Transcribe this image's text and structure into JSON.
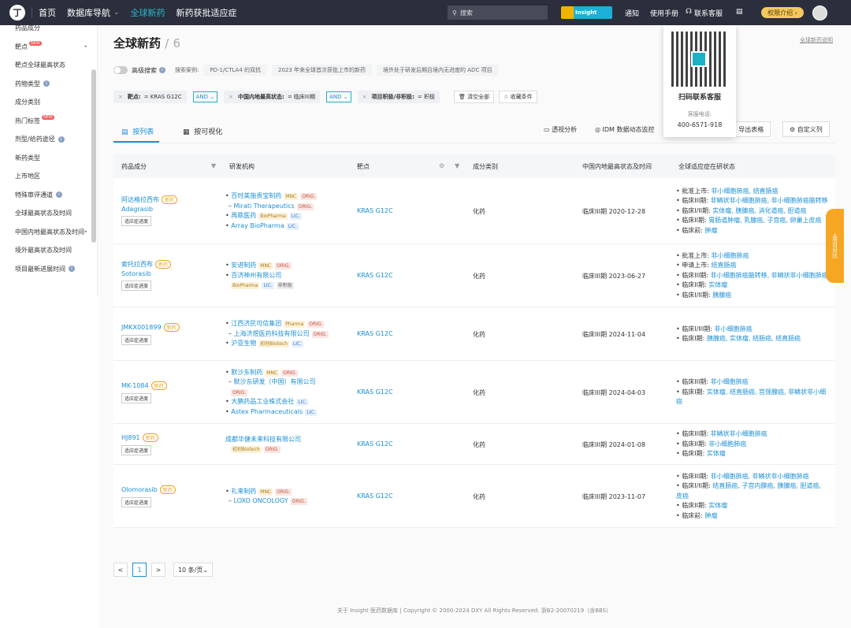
{
  "nav": {
    "logo": "丁",
    "home": "首页",
    "db_nav": "数据库导航",
    "global_new_drugs": "全球新药",
    "new_indications": "新药获批适应症",
    "search_placeholder": "搜索",
    "insight_label": "Insight",
    "notify": "通知",
    "manual": "使用手册",
    "contact": "联系客服",
    "perm": "权限介绍"
  },
  "sidebar": {
    "items": [
      {
        "label": "药品成分",
        "new": false,
        "info": false,
        "arrow": false
      },
      {
        "label": "靶点",
        "new": true,
        "info": false,
        "arrow": true
      },
      {
        "label": "靶点全球最高状态",
        "new": false,
        "info": false,
        "arrow": false
      },
      {
        "label": "药物类型",
        "new": false,
        "info": true,
        "arrow": false
      },
      {
        "label": "成分类别",
        "new": false,
        "info": false,
        "arrow": false
      },
      {
        "label": "热门标签",
        "new": true,
        "info": false,
        "arrow": false
      },
      {
        "label": "剂型/给药途径",
        "new": false,
        "info": true,
        "arrow": false
      },
      {
        "label": "新药类型",
        "new": false,
        "info": false,
        "arrow": false
      },
      {
        "label": "上市地区",
        "new": false,
        "info": false,
        "arrow": false
      },
      {
        "label": "特殊审评通道",
        "new": false,
        "info": true,
        "arrow": false
      },
      {
        "label": "全球最高状态及时间",
        "new": false,
        "info": false,
        "arrow": false
      },
      {
        "label": "中国内地最高状态及时间",
        "new": false,
        "info": false,
        "arrow": true
      },
      {
        "label": "境外最高状态及时间",
        "new": false,
        "info": false,
        "arrow": false
      },
      {
        "label": "项目最新进展时间",
        "new": false,
        "info": true,
        "arrow": false
      }
    ],
    "new_text": "NEW"
  },
  "page": {
    "title": "全球新药",
    "sep": "/",
    "count": "6",
    "desc_link": "全球新药说明",
    "adv_search": "高级搜索",
    "examples_label": "搜索案例:",
    "examples": [
      "PD-1/CTLA4 的双抗",
      "2023 年来全球首次获批上市的新药",
      "境外处于研发后期且境内无进度的 ADC 项目"
    ]
  },
  "filters": {
    "f1_key": "靶点:",
    "f1_val": "= KRAS G12C",
    "and1": "AND",
    "f2_key": "中国内地最高状态:",
    "f2_val": "= 临床III期",
    "and2": "AND",
    "f3_key": "项目积极/非积极:",
    "f3_val": "= 积极",
    "clear": "清空全部",
    "save": "收藏条件"
  },
  "tabs": {
    "list": "按列表",
    "visual": "按可视化",
    "pivot": "透视分析",
    "idm": "IDM 数据动态监控",
    "export": "导出表格",
    "custom": "自定义列"
  },
  "table": {
    "headers": {
      "drug": "药品成分",
      "org": "研发机构",
      "target": "靶点",
      "category": "成分类别",
      "cn_status": "中国内地最高状态及时间",
      "global": "全球适应症在研状态"
    },
    "new_badge": "新药",
    "progress_btn": "适应症进度",
    "rows": [
      {
        "cn": "阿达格拉西布",
        "en": "Adagrasib",
        "orgs": [
          {
            "prefix": "•",
            "name": "百时美施贵宝制药",
            "tags": [
              [
                "MNC",
                "t-mnc"
              ],
              [
                "ORIG.",
                "t-orig"
              ]
            ]
          },
          {
            "prefix": "–",
            "name": "Mirati Therapeutics",
            "tags": [
              [
                "ORIG.",
                "t-orig"
              ]
            ]
          },
          {
            "prefix": "•",
            "name": "再鼎医药",
            "tags": [
              [
                "BioPharma",
                "t-bio"
              ],
              [
                "LIC.",
                "t-lic"
              ]
            ]
          },
          {
            "prefix": "•",
            "name": "Array BioPharma",
            "tags": [
              [
                "LIC.",
                "t-lic"
              ]
            ]
          }
        ],
        "target": "KRAS G12C",
        "category": "化药",
        "cn_status": "临床III期 2020-12-28",
        "global": [
          "• 批准上市: 非小细胞肺癌, 结直肠癌",
          "• 临床III期: 非鳞状非小细胞肺癌, 非小细胞肺癌脑转移",
          "• 临床I/II期: 实体瘤, 胰腺癌, 消化道癌, 胆道癌",
          "• 临床II期: 胃肠道肿瘤, 乳腺癌, 子宫癌, 卵巢上皮癌",
          "• 临床前: 肿瘤"
        ]
      },
      {
        "cn": "索托拉西布",
        "en": "Sotorasib",
        "orgs": [
          {
            "prefix": "•",
            "name": "安进制药",
            "tags": [
              [
                "MNC",
                "t-mnc"
              ],
              [
                "ORIG.",
                "t-orig"
              ]
            ]
          },
          {
            "prefix": "•",
            "name": "百济神州有限公司",
            "tags": []
          },
          {
            "prefix": "",
            "name": "",
            "tags": [
              [
                "BioPharma",
                "t-bio"
              ],
              [
                "LIC.",
                "t-lic"
              ],
              [
                "非积极",
                "t-gray"
              ]
            ]
          }
        ],
        "target": "KRAS G12C",
        "category": "化药",
        "cn_status": "临床III期 2023-06-27",
        "global": [
          "• 批准上市: 非小细胞肺癌",
          "• 申请上市: 结直肠癌",
          "• 临床III期: 非小细胞肺癌脑转移, 非鳞状非小细胞肺癌",
          "• 临床II期: 实体瘤",
          "• 临床I/II期: 胰腺癌"
        ]
      },
      {
        "cn": "JMKX001899",
        "en": "",
        "orgs": [
          {
            "prefix": "•",
            "name": "江西济民可信集团",
            "tags": [
              [
                "Pharma",
                "t-mnc"
              ],
              [
                "ORIG.",
                "t-orig"
              ]
            ]
          },
          {
            "prefix": "–",
            "name": "上海济煜医药科技有限公司",
            "tags": [
              [
                "ORIG.",
                "t-orig"
              ]
            ]
          },
          {
            "prefix": "•",
            "name": "沪亚生物",
            "tags": [
              [
                "初创Biotech",
                "t-bio"
              ],
              [
                "LIC.",
                "t-lic"
              ]
            ]
          }
        ],
        "target": "KRAS G12C",
        "category": "化药",
        "cn_status": "临床III期 2024-11-04",
        "global": [
          "• 临床I/III期: 非小细胞肺癌",
          "• 临床I期: 胰腺癌, 实体瘤, 结肠癌, 结直肠癌"
        ]
      },
      {
        "cn": "MK-1084",
        "en": "",
        "orgs": [
          {
            "prefix": "•",
            "name": "默沙东制药",
            "tags": [
              [
                "MNC",
                "t-mnc"
              ],
              [
                "ORIG.",
                "t-orig"
              ]
            ]
          },
          {
            "prefix": "–",
            "name": "默沙东研发（中国）有限公司",
            "tags": []
          },
          {
            "prefix": "",
            "name": "",
            "tags": [
              [
                "ORIG.",
                "t-orig"
              ]
            ]
          },
          {
            "prefix": "•",
            "name": "大鹏药品工业株式会社",
            "tags": [
              [
                "LIC.",
                "t-lic"
              ]
            ]
          },
          {
            "prefix": "•",
            "name": "Astex Pharmaceuticals",
            "tags": [
              [
                "LIC.",
                "t-lic"
              ]
            ]
          }
        ],
        "target": "KRAS G12C",
        "category": "化药",
        "cn_status": "临床III期 2024-04-03",
        "global": [
          "• 临床III期: 非小细胞肺癌",
          "• 临床I期: 实体瘤, 结直肠癌, 宫颈腺癌, 非鳞状非小细",
          "  癌"
        ]
      },
      {
        "cn": "HJ891",
        "en": "",
        "orgs": [
          {
            "prefix": "",
            "name": "成都华健未来科技有限公司",
            "tags": []
          },
          {
            "prefix": "",
            "name": "",
            "tags": [
              [
                "初创Biotech",
                "t-bio"
              ],
              [
                "ORIG.",
                "t-orig"
              ]
            ]
          }
        ],
        "target": "KRAS G12C",
        "category": "化药",
        "cn_status": "临床III期 2024-01-08",
        "global": [
          "• 临床III期: 非鳞状非小细胞肺癌",
          "• 临床II期: 非小细胞肺癌",
          "• 临床I期: 实体瘤"
        ]
      },
      {
        "cn": "Olomorasib",
        "en": "",
        "orgs": [
          {
            "prefix": "•",
            "name": "礼来制药",
            "tags": [
              [
                "MNC",
                "t-mnc"
              ],
              [
                "ORIG.",
                "t-orig"
              ]
            ]
          },
          {
            "prefix": "–",
            "name": "LOXO ONCOLOGY",
            "tags": [
              [
                "ORIG.",
                "t-orig"
              ]
            ]
          }
        ],
        "target": "KRAS G12C",
        "category": "化药",
        "cn_status": "临床III期 2023-11-07",
        "global": [
          "• 临床III期: 非小细胞肺癌, 非鳞状非小细胞肺癌",
          "• 临床I/II期: 结直肠癌, 子宫内膜癌, 胰腺癌, 胆道癌,",
          "  皮癌",
          "• 临床II期: 实体瘤",
          "• 临床前: 肿瘤"
        ]
      }
    ]
  },
  "popup": {
    "title": "扫码联系客服",
    "phone_label": "客服电话:",
    "phone": "400-6571-918"
  },
  "sidetab": {
    "label": "项目对比"
  },
  "pager": {
    "prev": "<",
    "page": "1",
    "next": ">",
    "size": "10 条/页"
  },
  "footer": "关于 Insight 医药数据库 | Copyright © 2000-2024 DXY All Rights Reserved. 浙B2-20070219（含BBS）"
}
